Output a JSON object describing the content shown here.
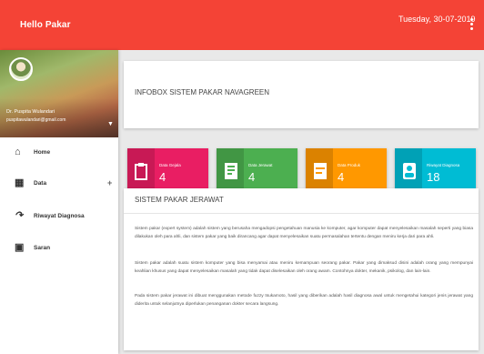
{
  "topbar": {
    "brand": "Hello Pakar",
    "date": "Tuesday, 30-07-2019",
    "color": "#f44336"
  },
  "profile": {
    "name": "Dr. Puspita Wulandari",
    "email": "puspitawulandari@gmail.com"
  },
  "menu": [
    {
      "label": "Home",
      "icon": "home-icon"
    },
    {
      "label": "Data",
      "icon": "grid-icon",
      "has_submenu": true
    },
    {
      "label": "Riwayat Diagnosa",
      "icon": "history-icon"
    },
    {
      "label": "Saran",
      "icon": "message-icon"
    }
  ],
  "infobox": {
    "title": "INFOBOX SISTEM PAKAR NAVAGREEN"
  },
  "stats": [
    {
      "label": "Data Gejala",
      "value": "4",
      "color": "#e91e63",
      "icon": "clipboard-icon"
    },
    {
      "label": "Data Jerawat",
      "value": "4",
      "color": "#4caf50",
      "icon": "document-icon"
    },
    {
      "label": "Data Produk",
      "value": "4",
      "color": "#ff9800",
      "icon": "list-icon"
    },
    {
      "label": "Riwayat Diagnosa",
      "value": "18",
      "color": "#00bcd4",
      "icon": "person-icon"
    }
  ],
  "about": {
    "title": "SISTEM PAKAR JERAWAT",
    "paragraphs": [
      "Sistem pakar (expert system) adalah sistem yang berusaha mengadopsi pengetahuan manusia ke komputer, agar komputer dapat menyelesaikan masalah seperti yang biasa dilakukan oleh para ahli, dan sistem pakar yang baik dirancang agar dapat menyelesaikan suatu permasalahan tertentu dengan meniru kerja dari para ahli.",
      "Sistem pakar adalah suatu sistem komputer yang bisa menyamai atau meniru kemampuan seorang pakar. Pakar yang dimaksud disini adalah orang yang mempunyai keahlian khusus yang dapat menyelesaikan masalah yang tidak dapat diselesaikan oleh orang awam. Contohnya dokter, mekanik, psikolog, dan lain-lain.",
      "Pada sistem pakar jerawat ini dibuat menggunakan metode fuzzy tsukamoto, hasil yang diberikan adalah hasil diagnosa awal untuk mengetahui kategori jenis jerawat yang diderita untuk selanjutnya diperlukan penanganan dokter secara langsung."
    ]
  }
}
